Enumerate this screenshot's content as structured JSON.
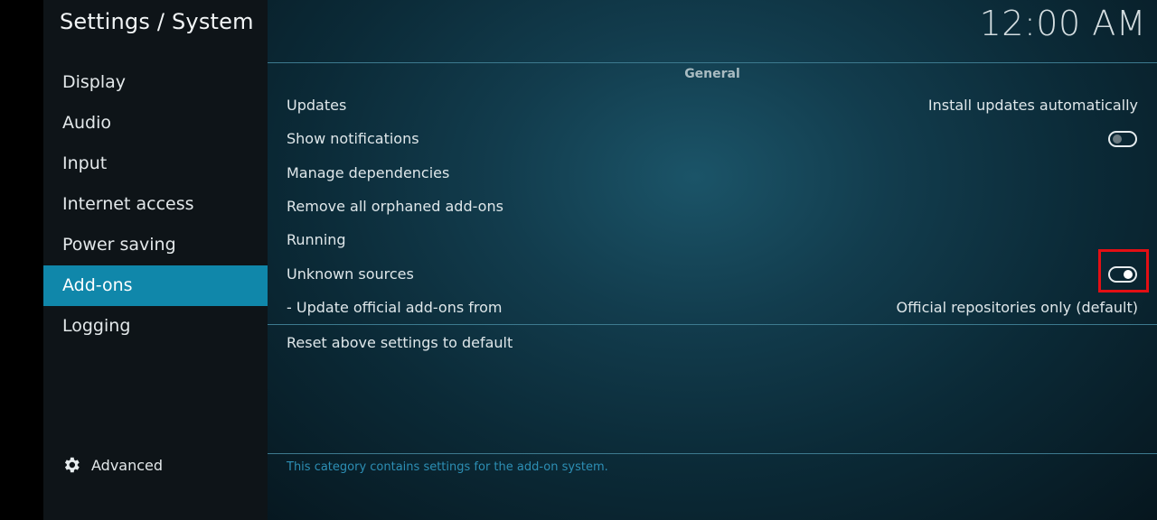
{
  "header": {
    "title": "Settings / System"
  },
  "clock": "12:00 AM",
  "sidebar": {
    "items": [
      {
        "label": "Display",
        "active": false
      },
      {
        "label": "Audio",
        "active": false
      },
      {
        "label": "Input",
        "active": false
      },
      {
        "label": "Internet access",
        "active": false
      },
      {
        "label": "Power saving",
        "active": false
      },
      {
        "label": "Add-ons",
        "active": true
      },
      {
        "label": "Logging",
        "active": false
      }
    ],
    "advanced_label": "Advanced"
  },
  "main": {
    "section_title": "General",
    "settings": [
      {
        "label": "Updates",
        "value": "Install updates automatically"
      },
      {
        "label": "Show notifications",
        "toggle": "off"
      },
      {
        "label": "Manage dependencies"
      },
      {
        "label": "Remove all orphaned add-ons"
      },
      {
        "label": "Running"
      },
      {
        "label": "Unknown sources",
        "toggle": "on",
        "highlighted": true
      },
      {
        "label": "- Update official add-ons from",
        "value": "Official repositories only (default)"
      }
    ],
    "reset_label": "Reset above settings to default",
    "description": "This category contains settings for the add-on system."
  },
  "colors": {
    "accent": "#1087aa",
    "highlight": "#e30f14",
    "description_text": "#2d8fb5"
  }
}
